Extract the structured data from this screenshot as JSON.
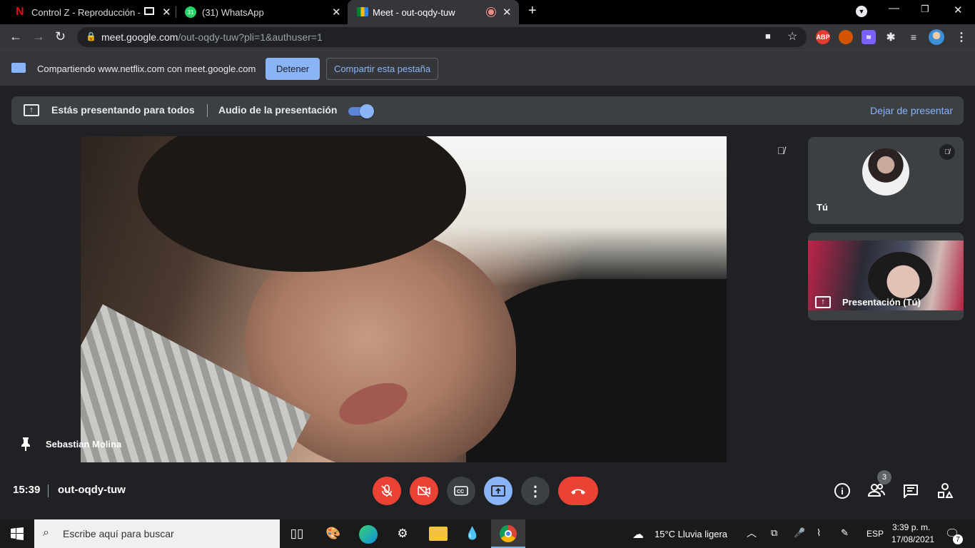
{
  "browser": {
    "tabs": [
      {
        "title": "Control Z - Reproducción - N",
        "favicon": "netflix-icon",
        "active": false
      },
      {
        "title": "(31) WhatsApp",
        "favicon": "whatsapp-icon",
        "badge": "31",
        "active": false
      },
      {
        "title": "Meet - out-oqdy-tuw",
        "favicon": "meet-icon",
        "active": true
      }
    ],
    "url_host": "meet.google.com",
    "url_path": "/out-oqdy-tuw?pli=1&authuser=1",
    "extensions": [
      "camera-icon",
      "star-icon",
      "abp-icon",
      "extension-icon",
      "extension-icon",
      "puzzle-icon",
      "media-icon",
      "profile-avatar"
    ],
    "abp_label": "ABP"
  },
  "sharebar": {
    "text": "Compartiendo www.netflix.com con meet.google.com",
    "stop_label": "Detener",
    "share_tab_label": "Compartir esta pestaña"
  },
  "banner": {
    "presenting_text": "Estás presentando para todos",
    "audio_label": "Audio de la presentación",
    "audio_enabled": true,
    "stop_presenting": "Dejar de presentar"
  },
  "main": {
    "participant_name": "Sebastian Molina",
    "muted": true
  },
  "tiles": [
    {
      "name": "Tú",
      "muted": true
    },
    {
      "name": "Presentación (Tú)"
    }
  ],
  "bottombar": {
    "time": "15:39",
    "meeting_code": "out-oqdy-tuw",
    "participants_count": "3",
    "colors": {
      "red": "#ea4335",
      "blue": "#8ab4f8",
      "gray": "#3c4043"
    }
  },
  "taskbar": {
    "search_placeholder": "Escribe aquí para buscar",
    "weather": "15°C  Lluvia ligera",
    "language": "ESP",
    "clock_time": "3:39 p. m.",
    "clock_date": "17/08/2021",
    "notifications": "7"
  }
}
